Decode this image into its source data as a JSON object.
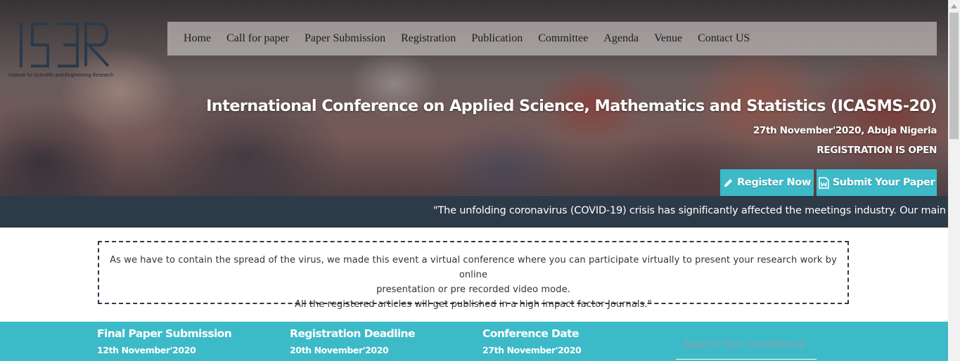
{
  "logo": {
    "caption": "Institute for Scientific and Engineering Research"
  },
  "nav": {
    "items": [
      "Home",
      "Call for paper",
      "Paper Submission",
      "Registration",
      "Publication",
      "Committee",
      "Agenda",
      "Venue",
      "Contact US"
    ]
  },
  "hero": {
    "title": "International Conference on Applied Science, Mathematics and Statistics (ICASMS-20)",
    "date_location": "27th November'2020, Abuja Nigeria",
    "registration_status": "REGISTRATION IS OPEN",
    "register_button": "Register Now",
    "submit_button": "Submit Your Paper"
  },
  "marquee": {
    "text": "\"The unfolding coronavirus (COVID-19) crisis has significantly affected the meetings industry. Our main"
  },
  "notice": {
    "line1": "As we have to contain the spread of the virus, we made this event a virtual conference where you can participate virtually to present your research work by online",
    "line2": "presentation or pre recorded video mode.",
    "line3": "All the registered articles will get published in a high impact factor Journals.\""
  },
  "info": {
    "final_paper_label": "Final Paper Submission",
    "final_paper_date": "12th November'2020",
    "registration_deadline_label": "Registration Deadline",
    "registration_deadline_date": "20th November'2020",
    "conference_date_label": "Conference Date",
    "conference_date": "27th November'2020"
  },
  "search": {
    "placeholder": "Search Your Conference"
  },
  "colors": {
    "accent": "#3dbac8",
    "dark_bar": "#2d3a48",
    "logo": "#2b3a4a"
  },
  "icons": [
    "pencil-icon",
    "word-document-icon",
    "scroll-up-arrow-icon"
  ]
}
